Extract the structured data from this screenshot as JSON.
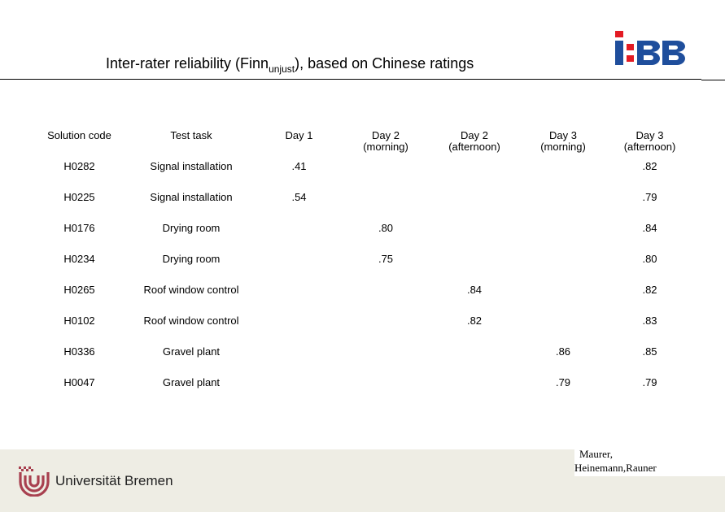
{
  "slide": {
    "title_main": "Inter-rater reliability (Finn",
    "title_sub": "unjust",
    "title_tail": "), based on Chinese ratings",
    "logo_ibb": "I:BB",
    "colors": {
      "ibb_blue": "#1f4e9c",
      "ibb_red": "#e31b23",
      "ub_red": "#a8404f",
      "footer_bg": "#eeede4"
    }
  },
  "table": {
    "headers": [
      {
        "line1": "Solution code",
        "line2": ""
      },
      {
        "line1": "Test task",
        "line2": ""
      },
      {
        "line1": "Day 1",
        "line2": ""
      },
      {
        "line1": "Day 2",
        "line2": "(morning)"
      },
      {
        "line1": "Day 2",
        "line2": "(afternoon)"
      },
      {
        "line1": "Day 3",
        "line2": "(morning)"
      },
      {
        "line1": "Day 3",
        "line2": "(afternoon)"
      }
    ],
    "rows": [
      [
        "H0282",
        "Signal installation",
        ".41",
        "",
        "",
        "",
        ".82"
      ],
      [
        "H0225",
        "Signal installation",
        ".54",
        "",
        "",
        "",
        ".79"
      ],
      [
        "H0176",
        "Drying room",
        "",
        ".80",
        "",
        "",
        ".84"
      ],
      [
        "H0234",
        "Drying room",
        "",
        ".75",
        "",
        "",
        ".80"
      ],
      [
        "H0265",
        "Roof window control",
        "",
        "",
        ".84",
        "",
        ".82"
      ],
      [
        "H0102",
        "Roof window control",
        "",
        "",
        ".82",
        "",
        ".83"
      ],
      [
        "H0336",
        "Gravel plant",
        "",
        "",
        "",
        ".86",
        ".85"
      ],
      [
        "H0047",
        "Gravel plant",
        "",
        "",
        "",
        ".79",
        ".79"
      ]
    ]
  },
  "footer": {
    "university": "Universität Bremen",
    "authors_line1": "Maurer,",
    "authors_line2": "Heinemann,Rauner"
  }
}
